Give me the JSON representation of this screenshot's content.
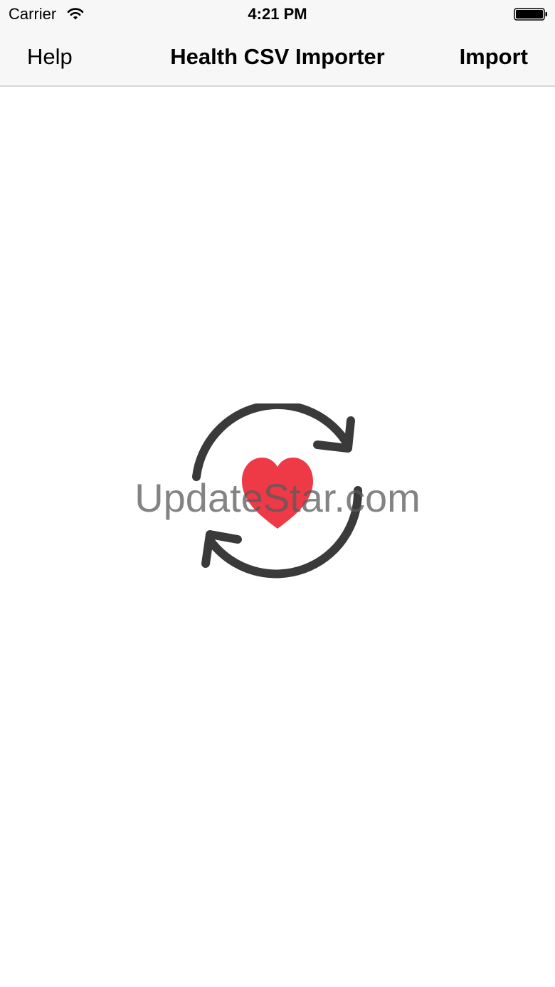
{
  "status_bar": {
    "carrier": "Carrier",
    "time": "4:21 PM",
    "wifi_icon": "wifi-icon",
    "battery_icon": "battery-full-icon"
  },
  "nav_bar": {
    "left_label": "Help",
    "title": "Health CSV Importer",
    "right_label": "Import"
  },
  "content": {
    "logo_icon": "sync-heart-icon",
    "watermark": "UpdateStar.com"
  },
  "colors": {
    "bar_background": "#f7f7f7",
    "heart": "#ee3a47",
    "arrows": "#3a3a3a"
  }
}
